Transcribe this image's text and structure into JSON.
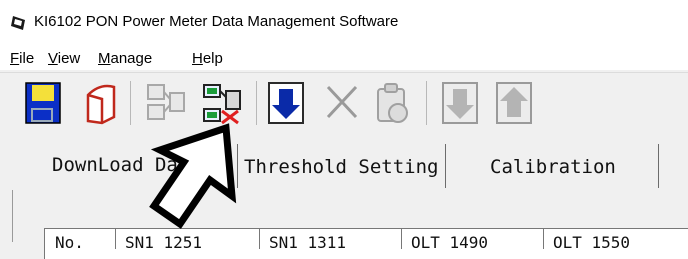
{
  "window": {
    "title": "KI6102 PON Power Meter Data Management Software"
  },
  "menu": {
    "items": [
      {
        "key": "file",
        "accel": "F",
        "rest": "ile"
      },
      {
        "key": "view",
        "accel": "V",
        "rest": "iew"
      },
      {
        "key": "manage",
        "accel": "M",
        "rest": "anage"
      },
      {
        "key": "help",
        "accel": "H",
        "rest": "elp"
      }
    ]
  },
  "toolbar": {
    "buttons": [
      {
        "icon": "save-icon",
        "enabled": true
      },
      {
        "icon": "eraser-icon",
        "enabled": true
      },
      {
        "icon": "connect-icon",
        "enabled": false
      },
      {
        "icon": "disconnect-icon",
        "enabled": true
      },
      {
        "icon": "download-icon",
        "enabled": true
      },
      {
        "icon": "delete-icon",
        "enabled": false
      },
      {
        "icon": "clipboard-icon",
        "enabled": false
      },
      {
        "icon": "move-down-icon",
        "enabled": false
      },
      {
        "icon": "move-up-icon",
        "enabled": false
      }
    ]
  },
  "tabs": [
    {
      "label": "DownLoad Da"
    },
    {
      "label": "Threshold Setting"
    },
    {
      "label": "Calibration"
    }
  ],
  "table": {
    "headers": [
      "No.",
      "SN1 1251",
      "SN1 1311",
      "OLT 1490",
      "OLT 1550"
    ]
  }
}
